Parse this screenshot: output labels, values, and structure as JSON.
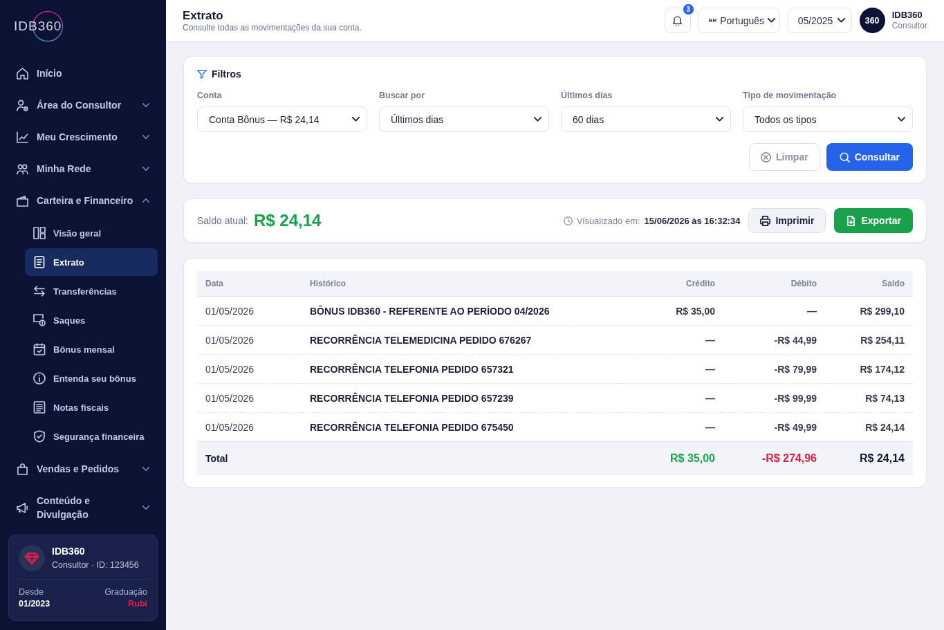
{
  "sidebar": {
    "logo": "IDB360",
    "nav": [
      {
        "label": "Início",
        "kind": "link",
        "selected": false
      },
      {
        "label": "Área do Consultor",
        "kind": "group",
        "expanded": false,
        "selected": false
      },
      {
        "label": "Meu Crescimento",
        "kind": "group",
        "expanded": false,
        "selected": false
      },
      {
        "label": "Minha Rede",
        "kind": "group",
        "expanded": false,
        "selected": false
      },
      {
        "label": "Carteira e Financeiro",
        "kind": "group",
        "expanded": true,
        "selected": false,
        "children": [
          {
            "label": "Visão geral",
            "selected": false
          },
          {
            "label": "Extrato",
            "selected": true
          },
          {
            "label": "Transferências",
            "selected": false
          },
          {
            "label": "Saques",
            "selected": false
          },
          {
            "label": "Bônus mensal",
            "selected": false
          },
          {
            "label": "Entenda seu bônus",
            "selected": false
          },
          {
            "label": "Notas fiscais",
            "selected": false
          },
          {
            "label": "Segurança financeira",
            "selected": false
          }
        ]
      },
      {
        "label": "Vendas e Pedidos",
        "kind": "group",
        "expanded": false,
        "selected": false
      },
      {
        "label": "Conteúdo e Divulgação",
        "kind": "group",
        "expanded": false,
        "selected": false
      }
    ],
    "user_card": {
      "name": "IDB360",
      "subtitle": "Consultor · ID: 123456",
      "since_label": "Desde",
      "since": "01/2023",
      "grade_label": "Graduação",
      "grade": "Rubi"
    }
  },
  "header": {
    "title": "Extrato",
    "subtitle": "Consulte todas as movimentações da sua conta.",
    "notifications": "3",
    "language": {
      "flag": "BR",
      "value": "Português"
    },
    "period": "05/2025",
    "avatar": "360",
    "user_name": "IDB360",
    "user_role": "Consultor"
  },
  "filters": {
    "title": "Filtros",
    "fields": [
      {
        "label": "Conta",
        "value": "Conta Bônus — R$ 24,14"
      },
      {
        "label": "Buscar por",
        "value": "Últimos dias"
      },
      {
        "label": "Últimos dias",
        "value": "60 dias"
      },
      {
        "label": "Tipo de movimentação",
        "value": "Todos os tipos"
      }
    ],
    "buttons": [
      {
        "label": "Limpar",
        "kind": "outline"
      },
      {
        "label": "Consultar",
        "kind": "primary"
      }
    ]
  },
  "balance": {
    "label": "Saldo atual:",
    "value": "R$ 24,14",
    "viewed_label": "Visualizado em:",
    "viewed_at": "15/06/2026 às 16:32:34",
    "buttons": [
      {
        "label": "Imprimir",
        "kind": "secondary"
      },
      {
        "label": "Exportar",
        "kind": "success"
      }
    ]
  },
  "table": {
    "columns": [
      "Data",
      "Histórico",
      "Crédito",
      "Débito",
      "Saldo"
    ],
    "rows": [
      {
        "date": "01/05/2026",
        "description": "BÔNUS IDB360 - REFERENTE AO PERÍODO 04/2026",
        "credit": "R$ 35,00",
        "debit": "—",
        "balance": "R$ 299,10"
      },
      {
        "date": "01/05/2026",
        "description": "RECORRÊNCIA TELEMEDICINA PEDIDO 676267",
        "credit": "—",
        "debit": "-R$ 44,99",
        "balance": "R$ 254,11"
      },
      {
        "date": "01/05/2026",
        "description": "RECORRÊNCIA TELEFONIA PEDIDO 657321",
        "credit": "—",
        "debit": "-R$ 79,99",
        "balance": "R$ 174,12"
      },
      {
        "date": "01/05/2026",
        "description": "RECORRÊNCIA TELEFONIA PEDIDO 657239",
        "credit": "—",
        "debit": "-R$ 99,99",
        "balance": "R$ 74,13"
      },
      {
        "date": "01/05/2026",
        "description": "RECORRÊNCIA TELEFONIA PEDIDO 675450",
        "credit": "—",
        "debit": "-R$ 49,99",
        "balance": "R$ 24,14"
      }
    ],
    "total": {
      "label": "Total",
      "credit": "R$ 35,00",
      "debit": "-R$ 274,96",
      "balance": "R$ 24,14"
    }
  }
}
